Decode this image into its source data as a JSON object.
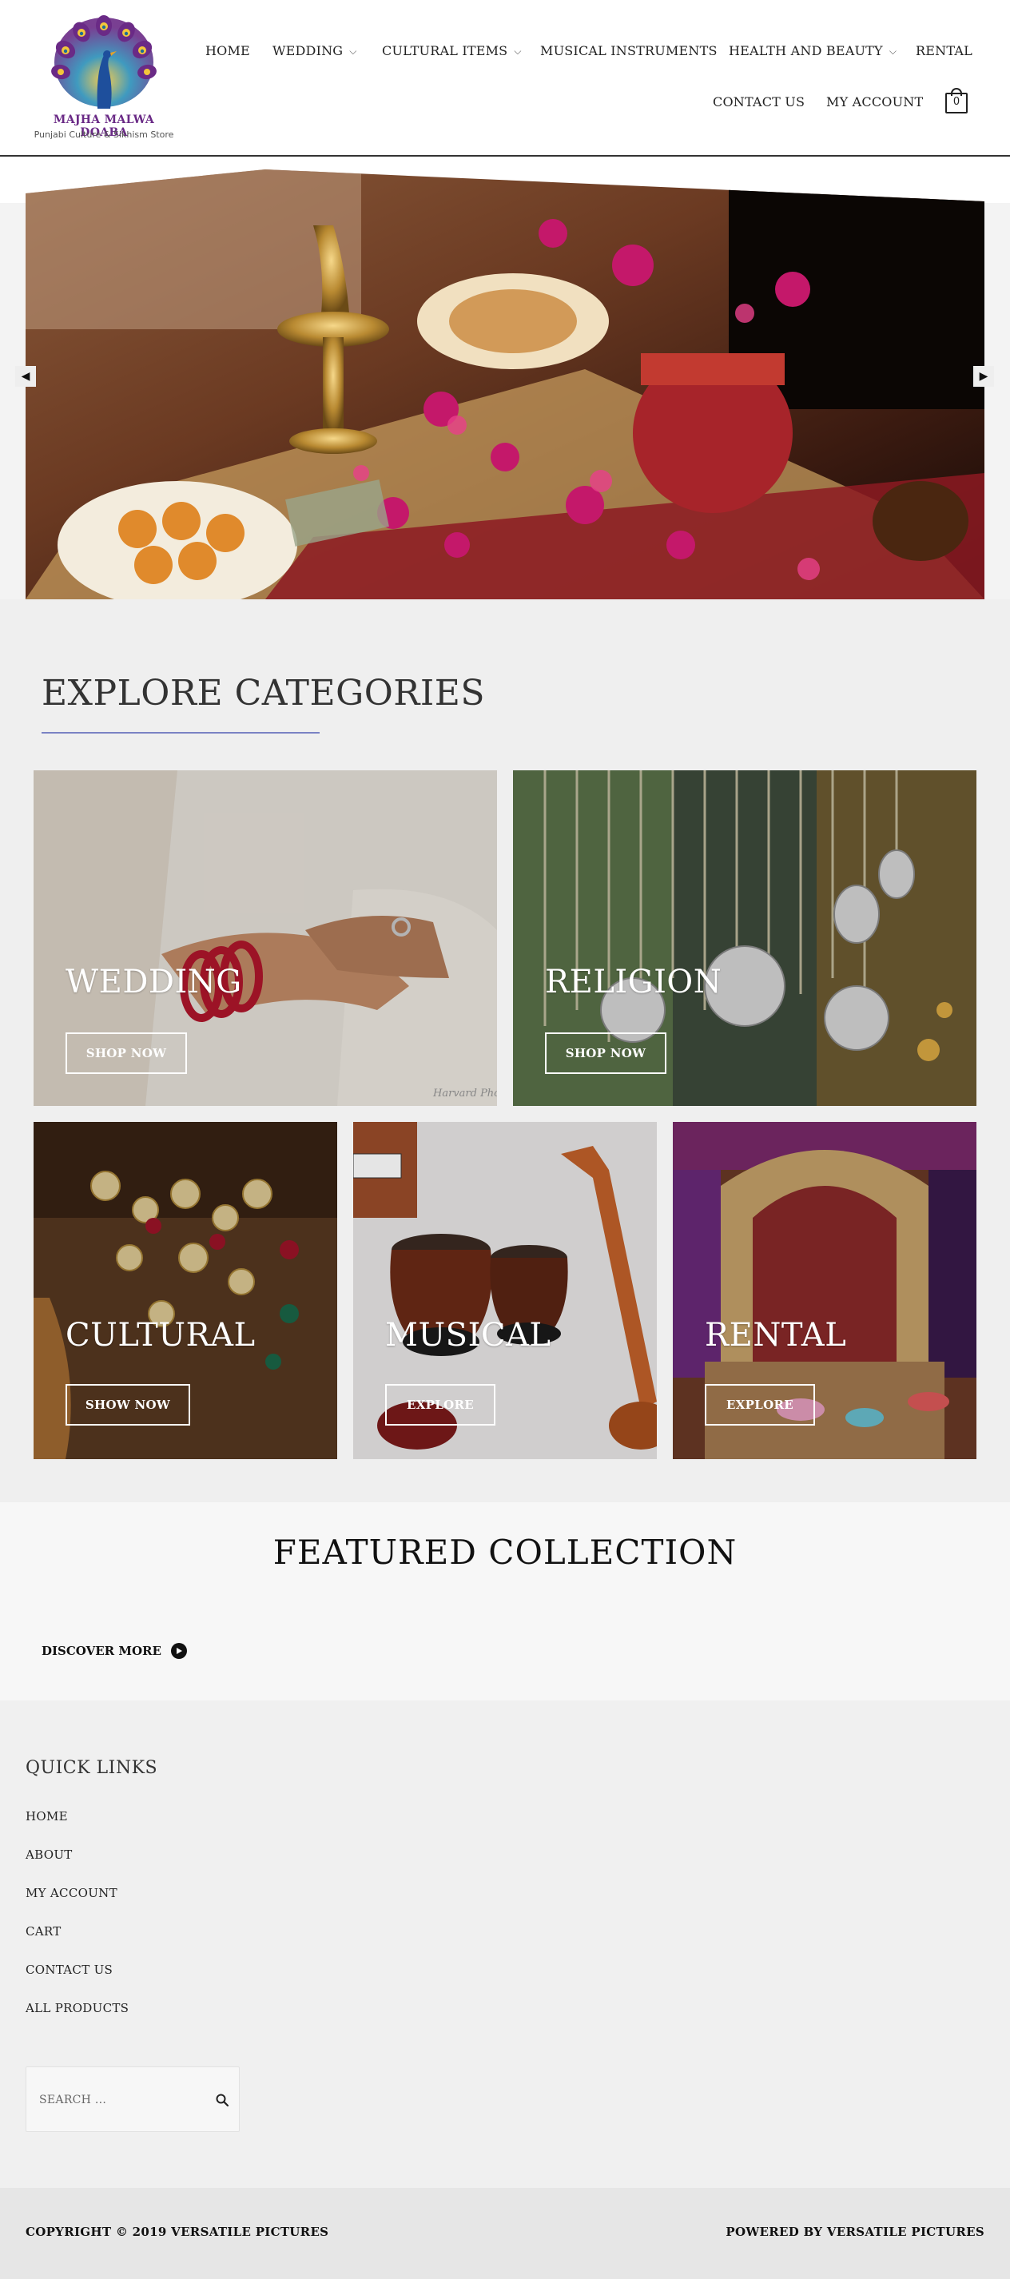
{
  "brand": {
    "name": "MAJHA MALWA DOABA",
    "tagline": "Punjabi Culture & Sikhism Store",
    "logo_icon": "peacock-logo",
    "colors": {
      "primary": "#6a2a86",
      "accent": "#7a83c4"
    }
  },
  "nav": {
    "items": [
      {
        "label": "HOME",
        "has_dropdown": false
      },
      {
        "label": "WEDDING",
        "has_dropdown": true
      },
      {
        "label": "CULTURAL ITEMS",
        "has_dropdown": true
      },
      {
        "label": "MUSICAL INSTRUMENTS",
        "has_dropdown": false
      },
      {
        "label": "HEALTH AND BEAUTY",
        "has_dropdown": true
      },
      {
        "label": "RENTAL",
        "has_dropdown": false
      },
      {
        "label": "CONTACT US",
        "has_dropdown": false
      },
      {
        "label": "MY ACCOUNT",
        "has_dropdown": false
      }
    ],
    "cart_count": "0",
    "cart_icon": "shopping-bag-icon"
  },
  "hero": {
    "prev_icon": "arrow-left-icon",
    "next_icon": "arrow-right-icon",
    "image": "wedding-ceremony-table"
  },
  "categories": {
    "title": "EXPLORE CATEGORIES",
    "cards": [
      {
        "title": "WEDDING",
        "button": "SHOP NOW",
        "image": "wedding-hands"
      },
      {
        "title": "RELIGION",
        "button": "SHOP NOW",
        "image": "khanda-pendants"
      },
      {
        "title": "CULTURAL",
        "button": "SHOW NOW",
        "image": "jewellery"
      },
      {
        "title": "MUSICAL",
        "button": "EXPLORE",
        "image": "tabla-sitar"
      },
      {
        "title": "RENTAL",
        "button": "EXPLORE",
        "image": "decor-setup"
      }
    ]
  },
  "featured": {
    "title": "FEATURED COLLECTION",
    "discover_label": "DISCOVER MORE",
    "discover_icon": "play-circle-icon"
  },
  "footer": {
    "quick_links_title": "QUICK LINKS",
    "links": [
      "HOME",
      "ABOUT",
      "MY ACCOUNT",
      "CART",
      "CONTACT US",
      "ALL PRODUCTS"
    ],
    "search_placeholder": "SEARCH ...",
    "copyright": "COPYRIGHT © 2019 VERSATILE PICTURES",
    "powered_by": "POWERED BY VERSATILE PICTURES"
  }
}
